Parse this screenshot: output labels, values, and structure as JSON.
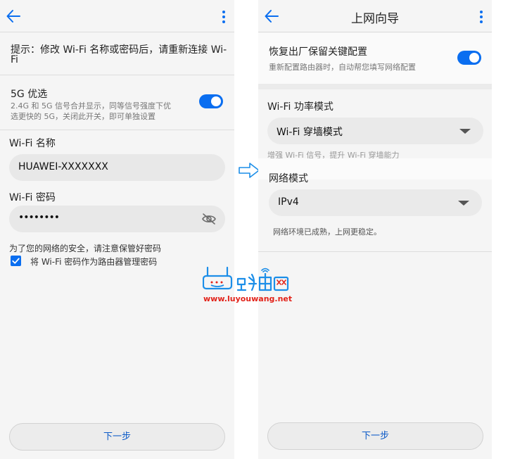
{
  "left": {
    "notice": "提示：修改 Wi-Fi 名称或密码后，请重新连接 Wi-Fi",
    "notice_line1": "提示：修改 Wi-Fi 名称或密码后，请重新连接 Wi-",
    "notice_line2": "Fi",
    "band_5g": {
      "title": "5G 优选",
      "desc_line1": "2.4G 和 5G 信号合并显示，同等信号强度下优",
      "desc_line2": "选更快的 5G，关闭此开关，即可单独设置",
      "toggle_on": true
    },
    "wifi_name": {
      "label": "Wi-Fi 名称",
      "value": "HUAWEI-XXXXXXX"
    },
    "wifi_password": {
      "label": "Wi-Fi 密码",
      "value": "••••••••"
    },
    "security_tip": "为了您的网络的安全，请注意保管好密码",
    "use_as_admin": {
      "label": "将 Wi-Fi 密码作为路由器管理密码",
      "checked": true
    },
    "next_label": "下一步"
  },
  "right": {
    "title": "上网向导",
    "restore": {
      "title": "恢复出厂保留关键配置",
      "desc": "重新配置路由器时，自动帮您填写网络配置",
      "toggle_on": true
    },
    "power_mode": {
      "label": "Wi-Fi 功率模式",
      "selected": "Wi-Fi 穿墙模式",
      "hint": "增强 Wi-Fi 信号，提升 Wi-Fi 穿墙能力"
    },
    "network_mode": {
      "label": "网络模式",
      "selected": "IPv4",
      "hint": "网络环境已成熟，上网更稳定。"
    },
    "next_label": "下一步"
  },
  "watermark": {
    "brand_text": "路由网",
    "url": "www.luyouwang.net"
  },
  "colors": {
    "accent": "#0A6EF0",
    "link_text": "#0A59C7",
    "watermark_blue": "#1C8EE8",
    "watermark_red": "#E2231A"
  },
  "icons": {
    "back": "arrow-left-icon",
    "more": "more-vertical-icon",
    "visibility": "eye-off-icon",
    "check": "checkmark-icon",
    "dropdown": "chevron-down-icon",
    "flow": "arrow-right-outline-icon",
    "watermark": "router-logo-icon"
  }
}
